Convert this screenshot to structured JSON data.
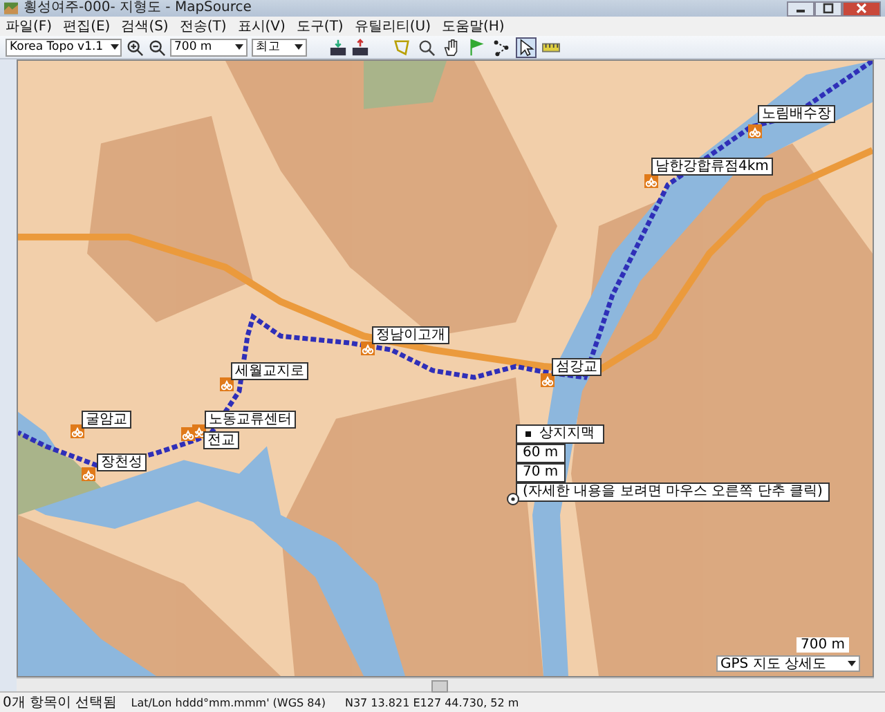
{
  "window": {
    "title": "횡성여주-000- 지형도 - MapSource"
  },
  "menu": [
    "파일(F)",
    "편집(E)",
    "검색(S)",
    "전송(T)",
    "표시(V)",
    "도구(T)",
    "유틸리티(U)",
    "도움말(H)"
  ],
  "toolbar": {
    "map_product": "Korea Topo v1.1",
    "zoom_scale": "700 m",
    "detail": "최고",
    "tools": [
      {
        "kind": "map",
        "selected": false
      },
      {
        "kind": "zoom",
        "selected": false
      },
      {
        "kind": "hand",
        "selected": false
      },
      {
        "kind": "flag",
        "selected": false
      },
      {
        "kind": "route",
        "selected": false
      },
      {
        "kind": "select",
        "selected": true
      },
      {
        "kind": "measure",
        "selected": false
      }
    ]
  },
  "map": {
    "waypoints": [
      {
        "label": "노림배수장"
      },
      {
        "label": "남한강합류점4km"
      },
      {
        "label": "정남이고개"
      },
      {
        "label": "세월교지로"
      },
      {
        "label": "섬강교"
      },
      {
        "label": "노동교류센터"
      },
      {
        "label": "전교"
      },
      {
        "label": "굴암교"
      },
      {
        "label": "장천성"
      }
    ],
    "tooltip": {
      "title": "상지지맥",
      "lines": [
        "60 m",
        "70 m"
      ],
      "hint": "(자세한 내용을 보려면 마우스 오른쪽 단추 클릭)"
    },
    "scale": "700 m",
    "detail_label": "GPS 지도 상세도"
  },
  "status_bar": [
    "0개 항목이 선택됨",
    "Lat/Lon hddd°mm.mmm' (WGS 84)",
    "N37 13.821 E127 44.730, 52 m"
  ]
}
